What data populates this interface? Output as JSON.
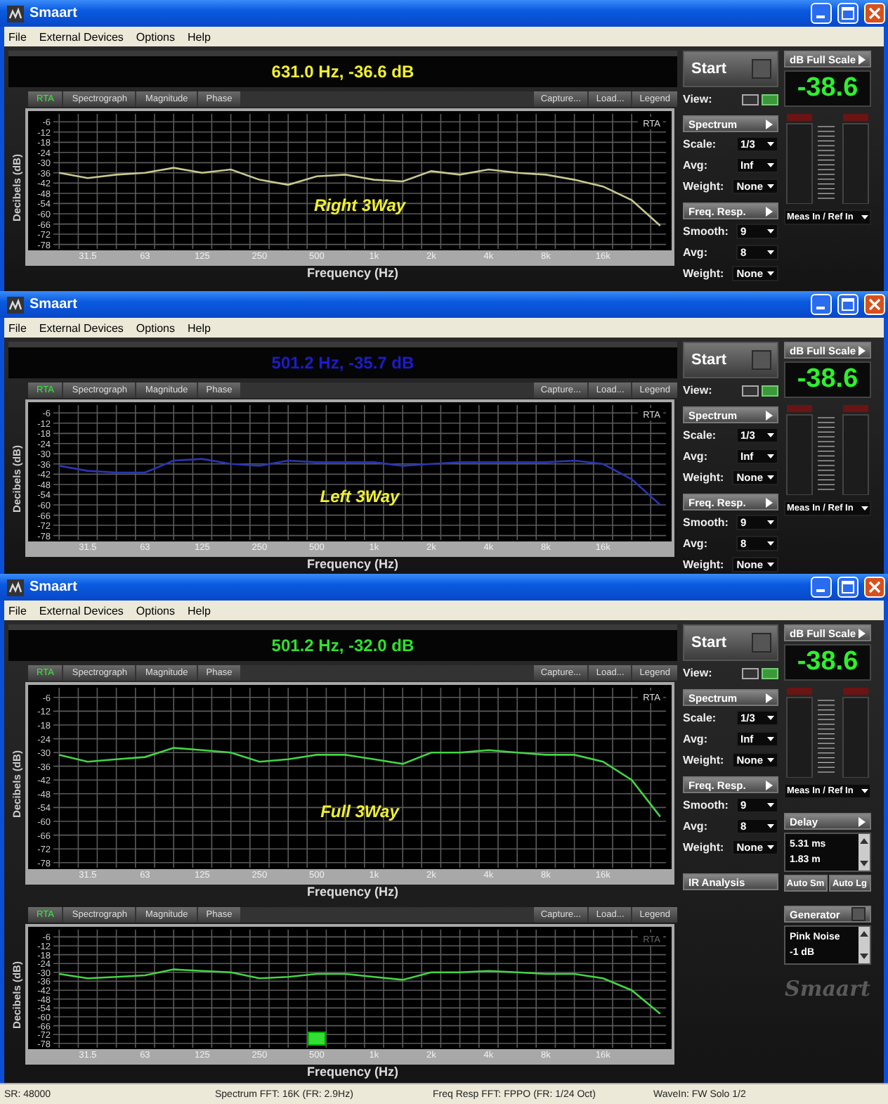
{
  "windows": [
    {
      "title": "Smaart",
      "menu": [
        "File",
        "External Devices",
        "Options",
        "Help"
      ],
      "readout": {
        "text": "631.0 Hz, -36.6 dB",
        "color": "#f0f030"
      },
      "charts": [
        {
          "tabs": [
            {
              "label": "RTA",
              "selected": true
            },
            {
              "label": "Spectrograph",
              "selected": false
            },
            {
              "label": "Magnitude",
              "selected": false
            },
            {
              "label": "Phase",
              "selected": false
            }
          ],
          "tools": [
            "Capture...",
            "Load...",
            "Legend"
          ],
          "mode_label": {
            "text": "RTA",
            "dimmed": false
          },
          "chart_data": {
            "type": "line",
            "xlabel": "Frequency (Hz)",
            "ylabel": "Decibels (dB)",
            "categories": [
              null,
              "31.5",
              null,
              "63",
              null,
              "125",
              null,
              "250",
              null,
              "500",
              null,
              "1k",
              null,
              "2k",
              null,
              "4k",
              null,
              "8k",
              null,
              "16k",
              null,
              null
            ],
            "grid": true,
            "series": [
              {
                "name": "Right 3Way",
                "color": "#c8c890",
                "values": [
                  -36,
                  -39,
                  -37,
                  -36,
                  -33,
                  -36,
                  -34,
                  -40,
                  -43,
                  -38,
                  -37,
                  -40,
                  -41,
                  -35,
                  -37,
                  -34,
                  -36,
                  -37,
                  -40,
                  -44,
                  -52,
                  -67
                ]
              }
            ],
            "ylim": [
              -79,
              -3
            ],
            "yticks": [
              -6,
              -12,
              -18,
              -24,
              -30,
              -36,
              -42,
              -48,
              -54,
              -60,
              -66,
              -72,
              -78
            ]
          }
        }
      ],
      "controls": {
        "start": "Start",
        "view": {
          "label": "View:",
          "options": [
            {
              "selected": false
            },
            {
              "selected": true
            }
          ]
        },
        "sections": [
          {
            "header": "Spectrum",
            "rows": [
              {
                "label": "Scale:",
                "value": "1/3"
              },
              {
                "label": "Avg:",
                "value": "Inf"
              },
              {
                "label": "Weight:",
                "value": "None"
              }
            ]
          },
          {
            "header": "Freq. Resp.",
            "rows": [
              {
                "label": "Smooth:",
                "value": "9"
              },
              {
                "label": "Avg:",
                "value": "8"
              },
              {
                "label": "Weight:",
                "value": "None"
              }
            ]
          }
        ]
      },
      "meter": {
        "scale_button": "dB Full Scale",
        "value": "-38.6",
        "source": "Meas In / Ref In"
      }
    },
    {
      "title": "Smaart",
      "menu": [
        "File",
        "External Devices",
        "Options",
        "Help"
      ],
      "readout": {
        "text": "501.2 Hz, -35.7 dB",
        "color": "#1c1ccc"
      },
      "charts": [
        {
          "tabs": [
            {
              "label": "RTA",
              "selected": true
            },
            {
              "label": "Spectrograph",
              "selected": false
            },
            {
              "label": "Magnitude",
              "selected": false
            },
            {
              "label": "Phase",
              "selected": false
            }
          ],
          "tools": [
            "Capture...",
            "Load...",
            "Legend"
          ],
          "mode_label": {
            "text": "RTA",
            "dimmed": false
          },
          "chart_data": {
            "type": "line",
            "xlabel": "Frequency (Hz)",
            "ylabel": "Decibels (dB)",
            "categories": [
              null,
              "31.5",
              null,
              "63",
              null,
              "125",
              null,
              "250",
              null,
              "500",
              null,
              "1k",
              null,
              "2k",
              null,
              "4k",
              null,
              "8k",
              null,
              "16k",
              null,
              null
            ],
            "grid": true,
            "series": [
              {
                "name": "Left 3Way",
                "color": "#2a36b0",
                "values": [
                  -37,
                  -40,
                  -41,
                  -41,
                  -34,
                  -33,
                  -36,
                  -37,
                  -34,
                  -35,
                  -35,
                  -35,
                  -37,
                  -36,
                  -35,
                  -35,
                  -35,
                  -35,
                  -34,
                  -36,
                  -45,
                  -60
                ]
              }
            ],
            "ylim": [
              -79,
              -3
            ],
            "yticks": [
              -6,
              -12,
              -18,
              -24,
              -30,
              -36,
              -42,
              -48,
              -54,
              -60,
              -66,
              -72,
              -78
            ]
          }
        }
      ],
      "controls": {
        "start": "Start",
        "view": {
          "label": "View:",
          "options": [
            {
              "selected": false
            },
            {
              "selected": true
            }
          ]
        },
        "sections": [
          {
            "header": "Spectrum",
            "rows": [
              {
                "label": "Scale:",
                "value": "1/3"
              },
              {
                "label": "Avg:",
                "value": "Inf"
              },
              {
                "label": "Weight:",
                "value": "None"
              }
            ]
          },
          {
            "header": "Freq. Resp.",
            "rows": [
              {
                "label": "Smooth:",
                "value": "9"
              },
              {
                "label": "Avg:",
                "value": "8"
              },
              {
                "label": "Weight:",
                "value": "None"
              }
            ]
          }
        ]
      },
      "meter": {
        "scale_button": "dB Full Scale",
        "value": "-38.6",
        "source": "Meas In / Ref In"
      }
    },
    {
      "title": "Smaart",
      "menu": [
        "File",
        "External Devices",
        "Options",
        "Help"
      ],
      "readout": {
        "text": "501.2 Hz, -32.0 dB",
        "color": "#30e030"
      },
      "charts": [
        {
          "tabs": [
            {
              "label": "RTA",
              "selected": true
            },
            {
              "label": "Spectrograph",
              "selected": false
            },
            {
              "label": "Magnitude",
              "selected": false
            },
            {
              "label": "Phase",
              "selected": false
            }
          ],
          "tools": [
            "Capture...",
            "Load...",
            "Legend"
          ],
          "mode_label": {
            "text": "RTA",
            "dimmed": false
          },
          "chart_data": {
            "type": "line",
            "xlabel": "Frequency (Hz)",
            "ylabel": "Decibels (dB)",
            "categories": [
              null,
              "31.5",
              null,
              "63",
              null,
              "125",
              null,
              "250",
              null,
              "500",
              null,
              "1k",
              null,
              "2k",
              null,
              "4k",
              null,
              "8k",
              null,
              "16k",
              null,
              null
            ],
            "grid": true,
            "series": [
              {
                "name": "Full 3Way",
                "color": "#44d444",
                "values": [
                  -31,
                  -34,
                  -33,
                  -32,
                  -28,
                  -29,
                  -30,
                  -34,
                  -33,
                  -31,
                  -31,
                  -33,
                  -35,
                  -30,
                  -30,
                  -29,
                  -30,
                  -31,
                  -31,
                  -34,
                  -42,
                  -58
                ]
              }
            ],
            "ylim": [
              -79,
              -3
            ],
            "yticks": [
              -6,
              -12,
              -18,
              -24,
              -30,
              -36,
              -42,
              -48,
              -54,
              -60,
              -66,
              -72,
              -78
            ]
          }
        },
        {
          "tabs": [
            {
              "label": "RTA",
              "selected": true
            },
            {
              "label": "Spectrograph",
              "selected": false
            },
            {
              "label": "Magnitude",
              "selected": false
            },
            {
              "label": "Phase",
              "selected": false
            }
          ],
          "tools": [
            "Capture...",
            "Load...",
            "Legend"
          ],
          "mode_label": {
            "text": "RTA",
            "dimmed": true
          },
          "cursor_marker": true,
          "chart_data": {
            "type": "line",
            "xlabel": "Frequency (Hz)",
            "ylabel": "Decibels (dB)",
            "categories": [
              null,
              "31.5",
              null,
              "63",
              null,
              "125",
              null,
              "250",
              null,
              "500",
              null,
              "1k",
              null,
              "2k",
              null,
              "4k",
              null,
              "8k",
              null,
              "16k",
              null,
              null
            ],
            "grid": true,
            "series": [
              {
                "color": "#44d444",
                "values": [
                  -31,
                  -34,
                  -33,
                  -32,
                  -28,
                  -29,
                  -30,
                  -34,
                  -33,
                  -31,
                  -31,
                  -33,
                  -35,
                  -30,
                  -30,
                  -29,
                  -30,
                  -31,
                  -31,
                  -34,
                  -42,
                  -58
                ]
              }
            ],
            "ylim": [
              -79,
              -3
            ],
            "yticks": [
              -6,
              -12,
              -18,
              -24,
              -30,
              -36,
              -42,
              -48,
              -54,
              -60,
              -66,
              -72,
              -78
            ]
          }
        }
      ],
      "controls": {
        "start": "Start",
        "view": {
          "label": "View:",
          "options": [
            {
              "selected": false
            },
            {
              "selected": true
            }
          ]
        },
        "sections": [
          {
            "header": "Spectrum",
            "rows": [
              {
                "label": "Scale:",
                "value": "1/3"
              },
              {
                "label": "Avg:",
                "value": "Inf"
              },
              {
                "label": "Weight:",
                "value": "None"
              }
            ]
          },
          {
            "header": "Freq. Resp.",
            "rows": [
              {
                "label": "Smooth:",
                "value": "9"
              },
              {
                "label": "Avg:",
                "value": "8"
              },
              {
                "label": "Weight:",
                "value": "None"
              }
            ]
          }
        ],
        "ir_button": "IR Analysis"
      },
      "meter": {
        "scale_button": "dB Full Scale",
        "value": "-38.6",
        "source": "Meas In / Ref In"
      },
      "delay": {
        "header": "Delay",
        "lines": [
          "5.31 ms",
          "1.83 m"
        ],
        "buttons": [
          "Auto Sm",
          "Auto Lg"
        ]
      },
      "generator": {
        "header": "Generator",
        "lines": [
          "Pink Noise",
          "-1 dB"
        ]
      },
      "logo": "Smaart",
      "status_bar": [
        "SR: 48000",
        "Spectrum FFT: 16K (FR: 2.9Hz)",
        "Freq Resp FFT: FPPO (FR: 1/24 Oct)",
        "WaveIn: FW Solo 1/2"
      ]
    }
  ]
}
